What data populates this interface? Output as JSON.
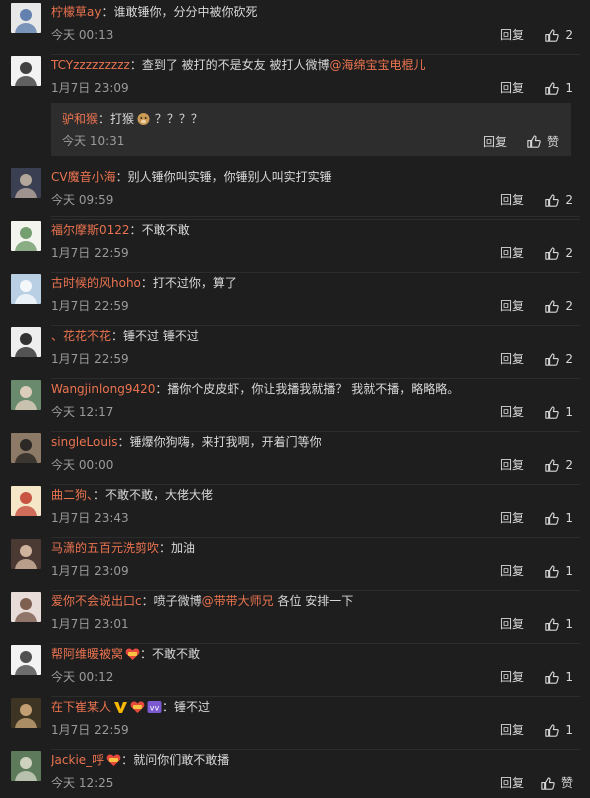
{
  "comments": [
    {
      "user": "柠檬草ay",
      "text": "谁敢锤你，分分中被你砍死",
      "time": "今天 00:13",
      "reply": "回复",
      "likes": "2",
      "avatar": {
        "bg": "#e8e8e8",
        "fg": "#4a6fa5"
      }
    },
    {
      "user": "TCYzzzzzzzzz",
      "text": "查到了 被打的不是女友 被打人微博",
      "mention": "@海绵宝宝电棍儿",
      "time": "1月7日 23:09",
      "reply": "回复",
      "likes": "1",
      "avatar": {
        "bg": "#f2f2f2",
        "fg": "#222222"
      },
      "sub": {
        "user": "驴和猴",
        "text": "打猴",
        "tail": " ？？？？",
        "time": "今天 10:31",
        "reply": "回复",
        "likes": "赞"
      }
    },
    {
      "user": "CV魔音小海",
      "text": "别人锤你叫实锤，你锤别人叫实打实锤",
      "time": "今天 09:59",
      "reply": "回复",
      "likes": "2",
      "avatar": {
        "bg": "#3a3f52",
        "fg": "#c9b8a8"
      }
    },
    {
      "user": "福尔摩斯0122",
      "text": "不敢不敢",
      "time": "1月7日 22:59",
      "reply": "回复",
      "likes": "2",
      "avatar": {
        "bg": "#f4f4ef",
        "fg": "#5e8f5a"
      }
    },
    {
      "user": "古时候的风hoho",
      "text": "打不过你，算了",
      "time": "1月7日 22:59",
      "reply": "回复",
      "likes": "2",
      "avatar": {
        "bg": "#b9cfe3",
        "fg": "#ffffff"
      }
    },
    {
      "user": "、花花不花",
      "text": "锤不过  锤不过",
      "time": "1月7日 22:59",
      "reply": "回复",
      "likes": "2",
      "avatar": {
        "bg": "#eeeeee",
        "fg": "#111111"
      }
    },
    {
      "user": "Wangjinlong9420",
      "text": "播你个皮皮虾，你让我播我就播？ 我就不播，略略略。",
      "time": "今天 12:17",
      "reply": "回复",
      "likes": "1",
      "avatar": {
        "bg": "#6a8a6e",
        "fg": "#f0d8c8"
      }
    },
    {
      "user": "singleLouis",
      "text": "锤爆你狗嗨，来打我啊，开着门等你",
      "time": "今天 00:00",
      "reply": "回复",
      "likes": "2",
      "avatar": {
        "bg": "#8c7a66",
        "fg": "#1a1a1a"
      }
    },
    {
      "user": "曲二狗、",
      "text": "不敢不敢，大佬大佬",
      "time": "1月7日 23:43",
      "reply": "回复",
      "likes": "1",
      "avatar": {
        "bg": "#f5e6c8",
        "fg": "#c0392b"
      }
    },
    {
      "user": "马潇的五百元洗剪吹",
      "text": "加油",
      "time": "1月7日 23:09",
      "reply": "回复",
      "likes": "1",
      "avatar": {
        "bg": "#4a3a33",
        "fg": "#e8c9b0"
      }
    },
    {
      "user": "爱你不会说出口c",
      "text": "喷子微博",
      "mention": "@带带大师兄",
      "after": " 各位 安排一下",
      "time": "1月7日 23:01",
      "reply": "回复",
      "likes": "1",
      "avatar": {
        "bg": "#e7dcd8",
        "fg": "#6b4a3a"
      }
    },
    {
      "user": "帮阿维暖被窝",
      "text": "不敢不敢",
      "time": "今天 00:12",
      "reply": "回复",
      "likes": "1",
      "badge1": true,
      "avatar": {
        "bg": "#f3f3f3",
        "fg": "#333333"
      }
    },
    {
      "user": "在下崔某人",
      "text": "锤不过",
      "time": "1月7日 22:59",
      "reply": "回复",
      "likes": "1",
      "badgeV": true,
      "badge1": true,
      "badge2": true,
      "avatar": {
        "bg": "#3d3424",
        "fg": "#d9b380"
      }
    },
    {
      "user": "Jackie_呼",
      "text": "就问你们敢不敢播",
      "time": "今天 12:25",
      "reply": "回复",
      "likes": "赞",
      "badge1": true,
      "avatar": {
        "bg": "#5d7a5a",
        "fg": "#e0e0d0"
      }
    }
  ],
  "icons": {
    "thumb": "thumbs-up-icon",
    "vip": "v-badge-icon",
    "fan": "fan-badge-icon"
  },
  "colors": {
    "username": "#eb7350",
    "background": "#1e1e1e",
    "sub_box": "#2d2d2d",
    "time": "#9b9b9b"
  }
}
